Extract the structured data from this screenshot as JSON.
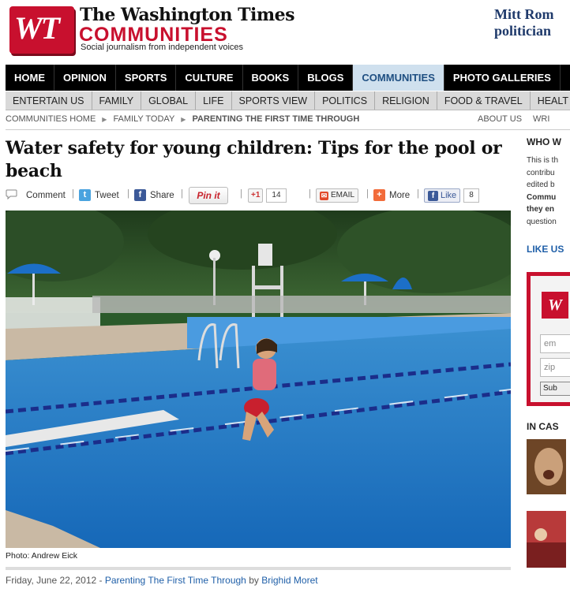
{
  "header": {
    "logo_text": "WT",
    "masthead": "The Washington Times",
    "communities": "COMMUNITIES",
    "tagline": "Social journalism from independent voices",
    "promo_line1": "Mitt Rom",
    "promo_line2": "politician"
  },
  "nav_primary": [
    {
      "label": "HOME"
    },
    {
      "label": "OPINION"
    },
    {
      "label": "SPORTS"
    },
    {
      "label": "CULTURE"
    },
    {
      "label": "BOOKS"
    },
    {
      "label": "BLOGS"
    },
    {
      "label": "COMMUNITIES",
      "active": true
    },
    {
      "label": "PHOTO GALLERIES"
    }
  ],
  "nav_secondary": [
    {
      "label": "ENTERTAIN US"
    },
    {
      "label": "FAMILY"
    },
    {
      "label": "GLOBAL"
    },
    {
      "label": "LIFE"
    },
    {
      "label": "SPORTS VIEW"
    },
    {
      "label": "POLITICS"
    },
    {
      "label": "RELIGION"
    },
    {
      "label": "FOOD & TRAVEL"
    },
    {
      "label": "HEALT"
    }
  ],
  "breadcrumb": {
    "items": [
      "COMMUNITIES HOME",
      "FAMILY TODAY",
      "PARENTING THE FIRST TIME THROUGH"
    ],
    "right": [
      "ABOUT US",
      "WRI"
    ]
  },
  "article": {
    "headline": "Water safety for young children: Tips for the pool or beach",
    "photo_caption": "Photo: Andrew Eick",
    "byline_date": "Friday, June 22, 2012 -",
    "byline_section": "Parenting The First Time Through",
    "byline_by": "by",
    "byline_author": "Brighid Moret"
  },
  "share": {
    "comment": "Comment",
    "tweet": "Tweet",
    "share": "Share",
    "pinit": "Pin it",
    "gplus": "+1",
    "gplus_count": "14",
    "email": "EMAIL",
    "more": "More",
    "like": "Like",
    "like_count": "8",
    "pipe": "|"
  },
  "sidebar": {
    "title": "WHO W",
    "text_lines": [
      "This is th",
      "contribu",
      "edited b",
      "Commu",
      "they en",
      "question"
    ],
    "like_us": "LIKE US",
    "signup_logo": "W",
    "field1": "em",
    "field2": "zip",
    "submit": "Sub",
    "in_case": "IN CAS"
  },
  "colors": {
    "brand_red": "#c8102e",
    "nav_active_bg": "#cfe0ee",
    "link_blue": "#1f5fa8"
  }
}
